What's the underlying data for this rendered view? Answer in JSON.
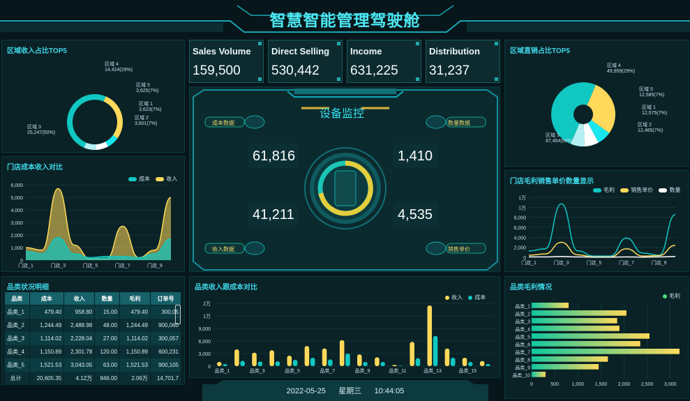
{
  "header": {
    "title": "智慧智能管理驾驶舱"
  },
  "kpis": [
    {
      "label": "Sales Volume",
      "value": "159,500"
    },
    {
      "label": "Direct Selling",
      "value": "530,442"
    },
    {
      "label": "Income",
      "value": "631,225"
    },
    {
      "label": "Distribution",
      "value": "31,237"
    }
  ],
  "monitor": {
    "title": "设备监控",
    "cost_label": "成本数据",
    "qty_label": "数量数据",
    "income_label": "收入数据",
    "price_label": "销售单价",
    "cost_value": "61,816",
    "qty_value": "1,410",
    "income_value": "41,211",
    "price_value": "4,535"
  },
  "panels": {
    "region_income": "区域收入占比TOP5",
    "store_cost": "门店成本收入对比",
    "category_table": "品类状况明细",
    "category_income": "品类收入跟成本对比",
    "region_direct": "区域直销占比TOP5",
    "store_margin": "门店毛利销售单价数量显示",
    "category_margin": "品类毛利情况"
  },
  "chart_data": [
    {
      "type": "pie",
      "title": "区域收入占比TOP5",
      "slices": [
        {
          "name": "区域_4",
          "value": 14424,
          "pct": "29%",
          "label": "14,424(29%)"
        },
        {
          "name": "区域_5",
          "value": 3625,
          "pct": "7%",
          "label": "3,625(7%)"
        },
        {
          "name": "区域_1",
          "value": 3623,
          "pct": "7%",
          "label": "3,623(7%)"
        },
        {
          "name": "区域_2",
          "value": 3601,
          "pct": "7%",
          "label": "3,601(7%)"
        },
        {
          "name": "区域_3",
          "value": 25247,
          "pct": "50%",
          "label": "25,247(50%)"
        }
      ],
      "colors": [
        "#ffd95a",
        "#19e7ef",
        "#ffffff",
        "#b5f0f2",
        "#10c7c2"
      ]
    },
    {
      "type": "area",
      "title": "门店成本收入对比",
      "categories": [
        "门店_1",
        "门店_2",
        "门店_3",
        "门店_4",
        "门店_5",
        "门店_6",
        "门店_7",
        "门店_8",
        "门店_9",
        "门店_10"
      ],
      "series": [
        {
          "name": "成本",
          "values": [
            700,
            500,
            1800,
            500,
            200,
            300,
            300,
            200,
            500,
            1700
          ]
        },
        {
          "name": "收入",
          "values": [
            1000,
            800,
            5700,
            1200,
            100,
            100,
            2700,
            200,
            800,
            5000
          ]
        }
      ],
      "ylim": [
        0,
        6000
      ],
      "yticks": [
        "0",
        "1,000",
        "2,000",
        "3,000",
        "4,000",
        "5,000",
        "6,000"
      ],
      "xticks": [
        "门店_1",
        "门店_3",
        "门店_5",
        "门店_7",
        "门店_9"
      ]
    },
    {
      "type": "pie",
      "title": "区域直销占比TOP5",
      "slices": [
        {
          "name": "区域_4",
          "value": 49959,
          "label": "49,959(29%)"
        },
        {
          "name": "区域_5",
          "value": 12585,
          "label": "12,585(7%)"
        },
        {
          "name": "区域_1",
          "value": 12575,
          "label": "12,575(7%)"
        },
        {
          "name": "区域_2",
          "value": 12465,
          "label": "12,465(7%)"
        },
        {
          "name": "区域_3",
          "value": 87454,
          "label": "87,454(50%)"
        }
      ],
      "colors": [
        "#ffd95a",
        "#19e7ef",
        "#ffffff",
        "#b5f0f2",
        "#10c7c2"
      ]
    },
    {
      "type": "line",
      "title": "门店毛利销售单价数量显示",
      "categories": [
        "门店_1",
        "门店_2",
        "门店_3",
        "门店_4",
        "门店_5",
        "门店_6",
        "门店_7",
        "门店_8",
        "门店_9",
        "门店_10"
      ],
      "series": [
        {
          "name": "毛利",
          "values": [
            1500,
            2000,
            12500,
            1500,
            300,
            300,
            4500,
            1000,
            500,
            10000
          ]
        },
        {
          "name": "销售单价",
          "values": [
            500,
            800,
            3500,
            600,
            100,
            100,
            2000,
            300,
            400,
            2800
          ]
        },
        {
          "name": "数量",
          "values": [
            100,
            100,
            200,
            100,
            50,
            50,
            100,
            50,
            100,
            200
          ]
        }
      ],
      "ylim": [
        0,
        14000
      ],
      "yticks": [
        "0",
        "2,000",
        "4,000",
        "6,000",
        "8,000",
        "1万",
        "1万"
      ],
      "xticks": [
        "门店_1",
        "门店_3",
        "门店_5",
        "门店_7",
        "门店_9"
      ]
    },
    {
      "type": "bar",
      "title": "品类收入跟成本对比",
      "categories": [
        "品类_1",
        "品类_2",
        "品类_3",
        "品类_4",
        "品类_5",
        "品类_6",
        "品类_7",
        "品类_8",
        "品类_9",
        "品类_10",
        "品类_11",
        "品类_12",
        "品类_13",
        "品类_14",
        "品类_15",
        "品类_16"
      ],
      "series": [
        {
          "name": "收入",
          "values": [
            1000,
            4000,
            3200,
            3800,
            2500,
            4800,
            4200,
            6200,
            2800,
            2100,
            300,
            5800,
            14500,
            4200,
            2000,
            1200
          ]
        },
        {
          "name": "成本",
          "values": [
            480,
            1250,
            1100,
            1150,
            1500,
            2000,
            1600,
            3000,
            1000,
            1000,
            100,
            1900,
            7200,
            2000,
            1000,
            500
          ]
        }
      ],
      "ylim": [
        0,
        15000
      ],
      "yticks": [
        "0",
        "3,000",
        "6,000",
        "9,000",
        "1万",
        "2万"
      ],
      "xticks": [
        "品类_1",
        "品类_3",
        "品类_5",
        "品类_7",
        "品类_9",
        "品类_11",
        "品类_13",
        "品类_15"
      ]
    },
    {
      "type": "bar",
      "title": "品类毛利情况",
      "orientation": "horizontal",
      "categories": [
        "品类_1",
        "品类_2",
        "品类_3",
        "品类_4",
        "品类_5",
        "品类_6",
        "品类_7",
        "品类_8",
        "品类_9",
        "品类_10"
      ],
      "series": [
        {
          "name": "毛利",
          "values": [
            800,
            2050,
            1850,
            1900,
            2550,
            2350,
            3200,
            1650,
            1450,
            300
          ]
        }
      ],
      "xlim": [
        0,
        3200
      ],
      "xticks": [
        "0",
        "500",
        "1,000",
        "1,500",
        "2,000",
        "2,500",
        "3,000"
      ]
    }
  ],
  "table": {
    "headers": [
      "品类",
      "成本",
      "收入",
      "数量",
      "毛利",
      "订单号"
    ],
    "rows": [
      [
        "品类_1",
        "479.40",
        "958.80",
        "15.00",
        "479.40",
        "300,05"
      ],
      [
        "品类_2",
        "1,244.49",
        "2,488.98",
        "48.00",
        "1,244.49",
        "900,060"
      ],
      [
        "品类_3",
        "1,114.02",
        "2,228.04",
        "27.00",
        "1,114.02",
        "300,057"
      ],
      [
        "品类_4",
        "1,150.89",
        "2,301.78",
        "120.00",
        "1,150.89",
        "600,231"
      ],
      [
        "品类_5",
        "1,521.53",
        "3,043.05",
        "63.00",
        "1,521.53",
        "900,105"
      ],
      [
        "总计",
        "20,605.35",
        "4.12万",
        "846.00",
        "2.06万",
        "14,701,7"
      ]
    ]
  },
  "footer": {
    "date": "2022-05-25",
    "weekday": "星期三",
    "time": "10:44:05"
  },
  "colors": {
    "accent": "#3fd6e8",
    "yellow": "#ffd95a",
    "teal": "#10c7c2",
    "bg": "#0a2226"
  }
}
